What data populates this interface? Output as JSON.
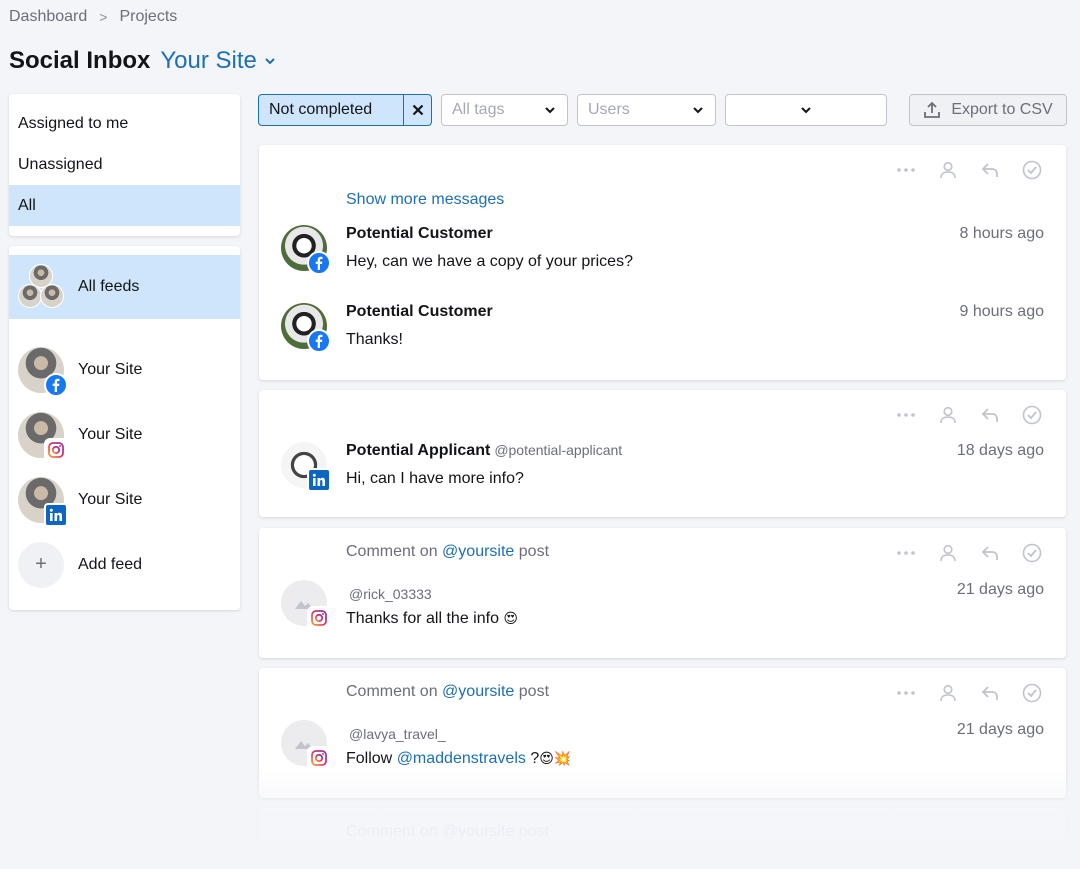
{
  "breadcrumb": {
    "items": [
      "Dashboard",
      "Projects"
    ],
    "separator": ">"
  },
  "header": {
    "title": "Social Inbox",
    "site": "Your Site"
  },
  "sidebar": {
    "filters": [
      {
        "label": "Assigned to me",
        "active": false
      },
      {
        "label": "Unassigned",
        "active": false
      },
      {
        "label": "All",
        "active": true
      }
    ],
    "feeds": {
      "all": "All feeds",
      "items": [
        {
          "label": "Your Site",
          "network": "facebook"
        },
        {
          "label": "Your Site",
          "network": "instagram"
        },
        {
          "label": "Your Site",
          "network": "linkedin"
        }
      ],
      "add": "Add feed",
      "add_icon": "+"
    }
  },
  "filterbar": {
    "status": "Not completed",
    "tags_placeholder": "All tags",
    "users_placeholder": "Users",
    "date_value": "",
    "export": "Export to CSV"
  },
  "cards": [
    {
      "show_more": "Show more messages",
      "messages": [
        {
          "author": "Potential Customer",
          "text": "Hey, can we have a copy of your prices?",
          "time": "8 hours ago",
          "network": "facebook"
        },
        {
          "author": "Potential Customer",
          "text": "Thanks!",
          "time": "9 hours ago",
          "network": "facebook"
        }
      ]
    },
    {
      "messages": [
        {
          "author": "Potential Applicant",
          "handle": "@potential-applicant",
          "text": "Hi, can I have more info?",
          "time": "18 days ago",
          "network": "linkedin"
        }
      ]
    },
    {
      "comment": {
        "prefix": "Comment on",
        "account": "@yoursite",
        "suffix": "post"
      },
      "messages": [
        {
          "username": "@rick_03333",
          "text": "Thanks for all the info",
          "emoji": "😍",
          "time": "21 days ago",
          "network": "instagram"
        }
      ]
    },
    {
      "comment": {
        "prefix": "Comment on",
        "account": "@yoursite",
        "suffix": "post"
      },
      "messages": [
        {
          "username": "@lavya_travel_",
          "text_prefix": "Follow",
          "mention": "@maddenstravels",
          "text_suffix": "?",
          "emoji": "😍💥",
          "time": "21 days ago",
          "network": "instagram"
        }
      ]
    },
    {
      "comment": {
        "prefix": "Comment on",
        "account": "@yoursite",
        "suffix": "post"
      }
    }
  ],
  "icons": {
    "more": "more-horizontal-icon",
    "assign": "user-icon",
    "reply": "reply-icon",
    "complete": "check-circle-icon"
  },
  "colors": {
    "accent": "#1c6fb7",
    "selected_bg": "#cfe5fb",
    "facebook": "#1877f2",
    "linkedin": "#0a66c2"
  }
}
